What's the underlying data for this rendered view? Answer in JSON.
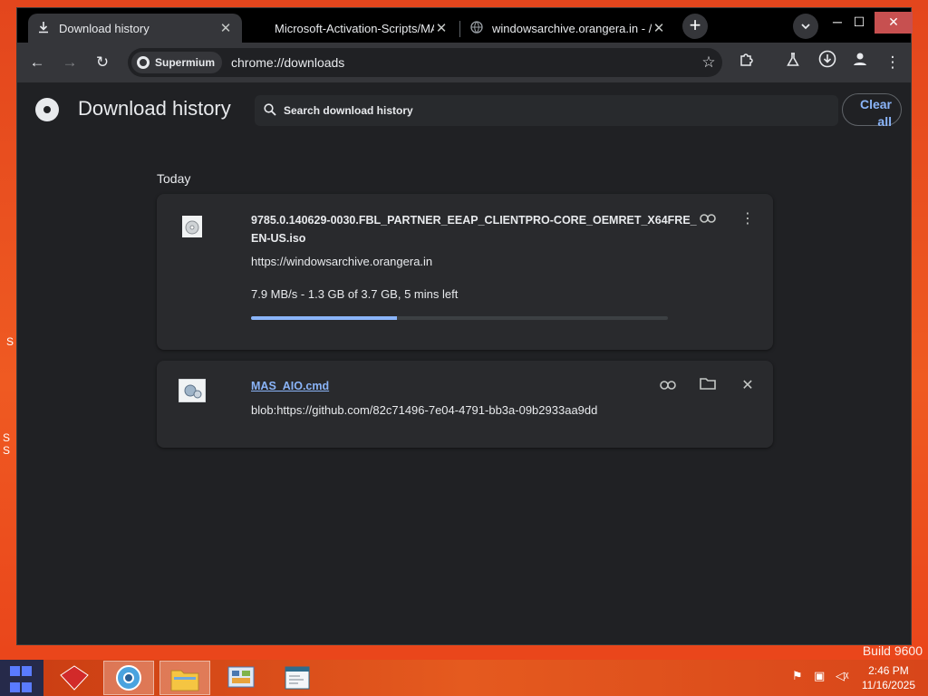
{
  "desktop": {
    "build_text": "Build 9600",
    "edge_letters": [
      "S",
      "S",
      "S"
    ]
  },
  "browser": {
    "tabs": [
      {
        "title": "Download history",
        "icon": "download-icon",
        "active": true
      },
      {
        "title": "Microsoft-Activation-Scripts/MAS",
        "icon": "github-icon",
        "active": false
      },
      {
        "title": "windowsarchive.orangera.in - /w",
        "icon": "globe-icon",
        "active": false
      }
    ],
    "new_tab_label": "+",
    "omnibox": {
      "chip_label": "Supermium",
      "url": "chrome://downloads"
    }
  },
  "page": {
    "title": "Download history",
    "search_placeholder": "Search download history",
    "clear_all_label": "Clear all",
    "section_date": "Today",
    "downloads": [
      {
        "name_line1": "9785.0.140629-0030.FBL_PARTNER_EEAP_CLIENTPRO-CORE_OEMRET_X64FRE_",
        "name_line2": "EN-US.iso",
        "url": "https://windowsarchive.orangera.in",
        "status": "7.9 MB/s - 1.3 GB of 3.7 GB, 5 mins left",
        "progress_fraction": 0.35,
        "icon": "disc-image-icon"
      },
      {
        "name": "MAS_AIO.cmd",
        "url": "blob:https://github.com/82c71496-7e04-4791-bb3a-09b2933aa9dd",
        "icon": "cmd-script-icon"
      }
    ]
  },
  "taskbar": {
    "apps": [
      "app-red-icon",
      "browser-icon",
      "file-explorer-icon",
      "control-panel-icon",
      "notepad-icon"
    ],
    "clock_time": "2:46 PM",
    "clock_date": "11/16/2025"
  },
  "colors": {
    "page_bg": "#202124",
    "card_bg": "#292a2d",
    "accent": "#8ab4f8",
    "desktop": "#e9431a"
  }
}
